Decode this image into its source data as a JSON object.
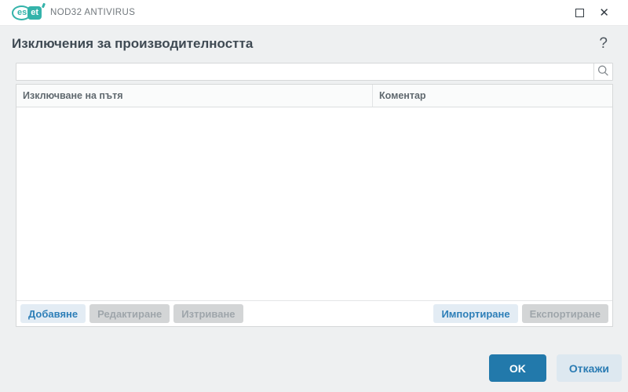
{
  "titlebar": {
    "logo_es": "es",
    "logo_et": "et",
    "brand": "NOD32 ANTIVIRUS",
    "close_glyph": "✕"
  },
  "header": {
    "title": "Изключения за производителността",
    "help_label": "?"
  },
  "search": {
    "value": "",
    "placeholder": ""
  },
  "table": {
    "columns": [
      "Изключване на пътя",
      "Коментар"
    ],
    "rows": []
  },
  "toolbar": {
    "add_label": "Добавяне",
    "edit_label": "Редактиране",
    "delete_label": "Изтриване",
    "import_label": "Импортиране",
    "export_label": "Експортиране"
  },
  "footer": {
    "ok_label": "OK",
    "cancel_label": "Откажи"
  },
  "icons": {
    "search": "magnifier",
    "maximize": "square-outline",
    "close": "x-mark"
  },
  "colors": {
    "brand_teal": "#34b3aa",
    "primary_blue": "#2279ab",
    "enabled_button_bg": "#e3ecf4",
    "enabled_button_text": "#2e7fb8",
    "disabled_button_bg": "#d3d5d6",
    "disabled_button_text": "#9fa6ab",
    "window_bg": "#eef0f1",
    "title_text": "#3f4a53"
  }
}
